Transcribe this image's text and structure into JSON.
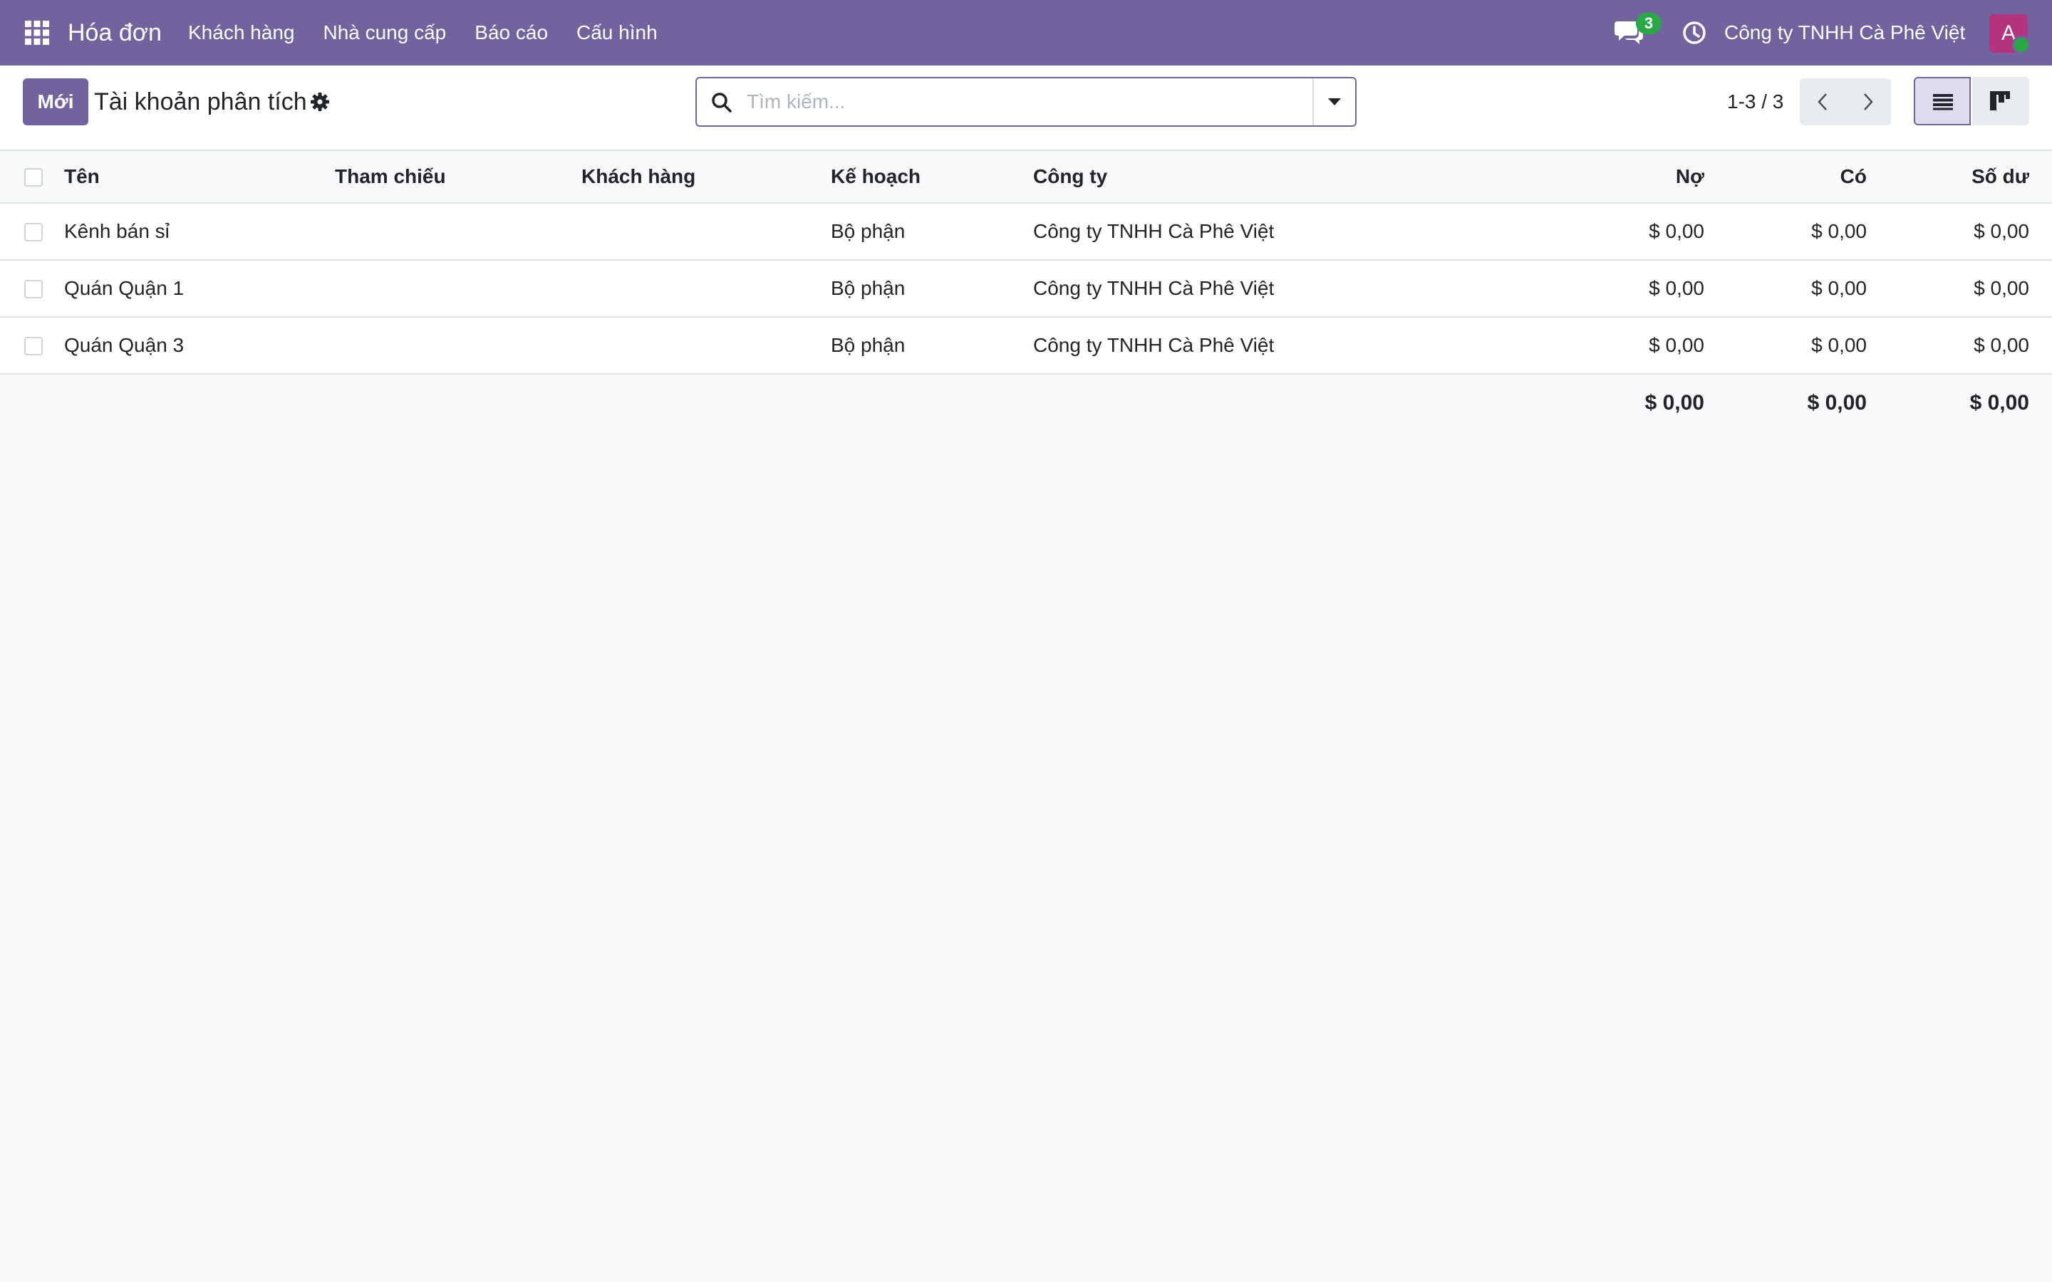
{
  "navbar": {
    "app_name": "Hóa đơn",
    "menu": [
      "Khách hàng",
      "Nhà cung cấp",
      "Báo cáo",
      "Cấu hình"
    ],
    "chat_count": "3",
    "company": "Công ty TNHH Cà Phê Việt",
    "avatar_letter": "A",
    "colors": {
      "brand": "#71639e",
      "badge": "#28a745",
      "avatar": "#b4337e"
    },
    "icons": [
      "apps-grid-icon",
      "chat-icon",
      "clock-icon"
    ]
  },
  "control_panel": {
    "new_label": "Mới",
    "title": "Tài khoản phân tích",
    "search_placeholder": "Tìm kiếm...",
    "pager": "1-3 / 3",
    "icons": [
      "gear-icon",
      "search-icon",
      "caret-down-icon",
      "chevron-left-icon",
      "chevron-right-icon",
      "list-view-icon",
      "kanban-view-icon"
    ]
  },
  "table": {
    "columns": [
      "Tên",
      "Tham chiếu",
      "Khách hàng",
      "Kế hoạch",
      "Công ty",
      "Nợ",
      "Có",
      "Số dư"
    ],
    "rows": [
      {
        "name": "Kênh bán sỉ",
        "reference": "",
        "customer": "",
        "plan": "Bộ phận",
        "company": "Công ty TNHH Cà Phê Việt",
        "debit": "$ 0,00",
        "credit": "$ 0,00",
        "balance": "$ 0,00"
      },
      {
        "name": "Quán Quận 1",
        "reference": "",
        "customer": "",
        "plan": "Bộ phận",
        "company": "Công ty TNHH Cà Phê Việt",
        "debit": "$ 0,00",
        "credit": "$ 0,00",
        "balance": "$ 0,00"
      },
      {
        "name": "Quán Quận 3",
        "reference": "",
        "customer": "",
        "plan": "Bộ phận",
        "company": "Công ty TNHH Cà Phê Việt",
        "debit": "$ 0,00",
        "credit": "$ 0,00",
        "balance": "$ 0,00"
      }
    ],
    "totals": {
      "debit": "$ 0,00",
      "credit": "$ 0,00",
      "balance": "$ 0,00"
    }
  }
}
